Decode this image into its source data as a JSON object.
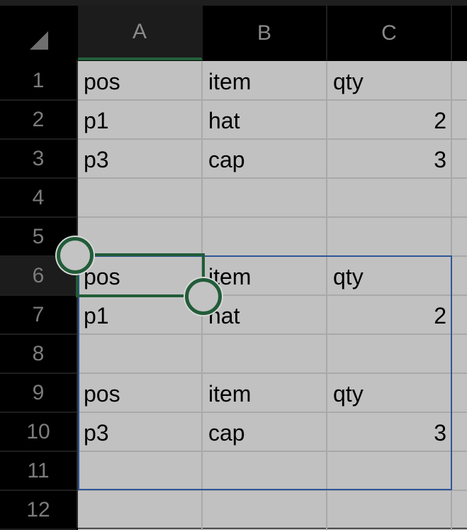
{
  "spreadsheet": {
    "select_all_icon": "select-all-triangle-icon",
    "columns": [
      {
        "label": "A",
        "active": true
      },
      {
        "label": "B",
        "active": false
      },
      {
        "label": "C",
        "active": false
      }
    ],
    "rows": [
      {
        "label": "1",
        "cells": [
          "pos",
          "item",
          "qty"
        ]
      },
      {
        "label": "2",
        "cells": [
          "p1",
          "hat",
          "2"
        ]
      },
      {
        "label": "3",
        "cells": [
          "p3",
          "cap",
          "3"
        ]
      },
      {
        "label": "4",
        "cells": [
          "",
          "",
          ""
        ]
      },
      {
        "label": "5",
        "cells": [
          "",
          "",
          ""
        ]
      },
      {
        "label": "6",
        "cells": [
          "pos",
          "item",
          "qty"
        ]
      },
      {
        "label": "7",
        "cells": [
          "p1",
          "hat",
          "2"
        ]
      },
      {
        "label": "8",
        "cells": [
          "",
          "",
          ""
        ]
      },
      {
        "label": "9",
        "cells": [
          "pos",
          "item",
          "qty"
        ]
      },
      {
        "label": "10",
        "cells": [
          "p3",
          "cap",
          "3"
        ]
      },
      {
        "label": "11",
        "cells": [
          "",
          "",
          ""
        ]
      },
      {
        "label": "12",
        "cells": [
          "",
          "",
          ""
        ]
      }
    ],
    "active_row": "6",
    "selected_cell": "A6",
    "highlighted_range": "A6:C11",
    "colors": {
      "selection": "#215c38",
      "range_border": "#2f5597",
      "cell_background": "#c1c1c1"
    }
  }
}
